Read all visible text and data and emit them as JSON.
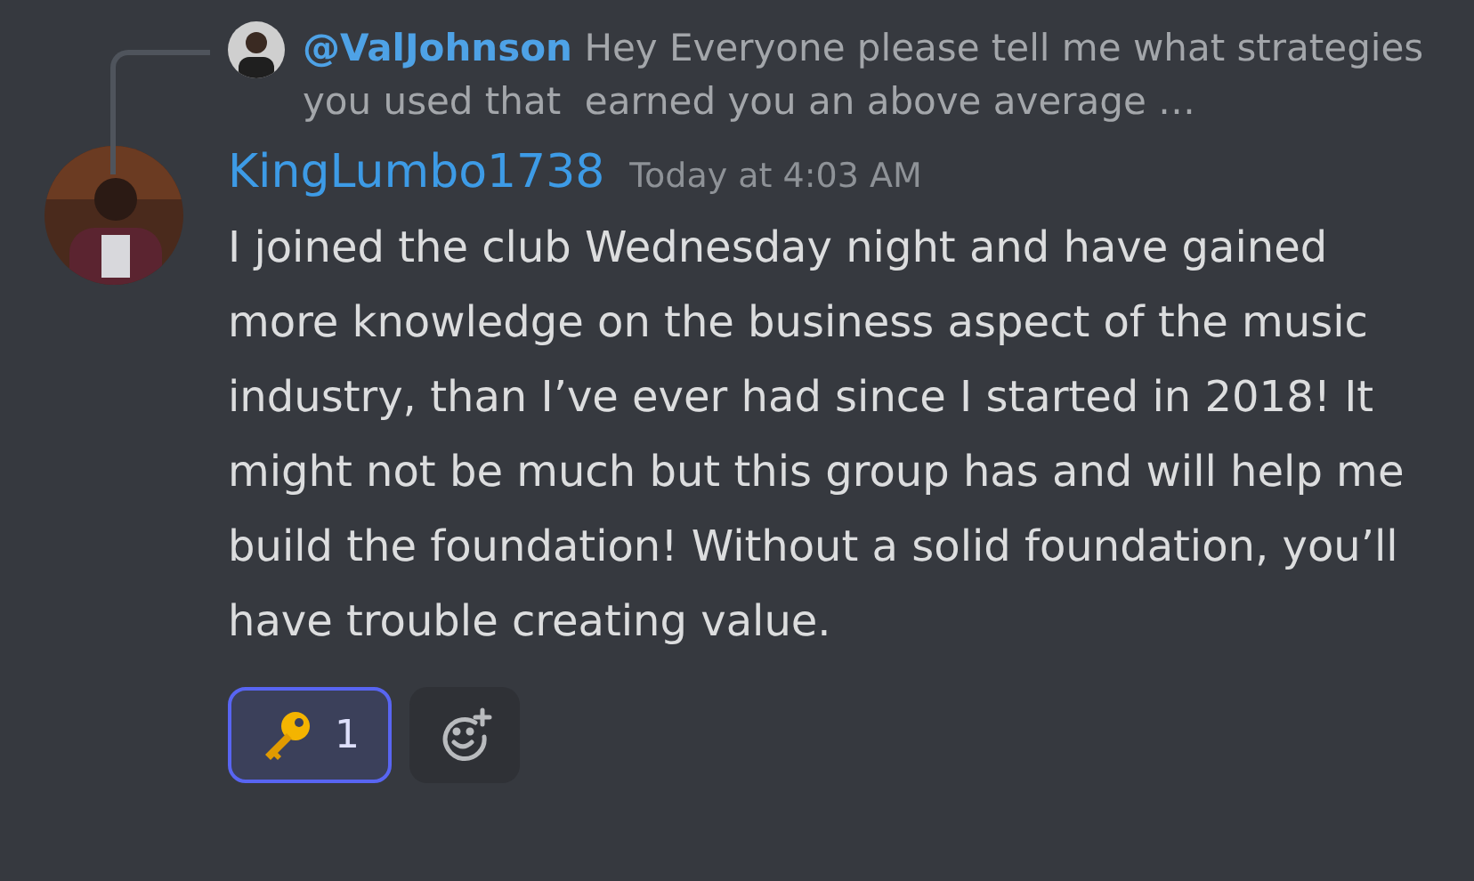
{
  "reply": {
    "mention": "@ValJohnson",
    "text": "Hey Everyone please tell me what strategies you used that  earned you an above average …"
  },
  "message": {
    "author": "KingLumbo1738",
    "timestamp": "Today at 4:03 AM",
    "body": "I joined the club Wednesday night and have gained more knowledge on the business aspect of the music industry, than I’ve ever had since I started in 2018! It might not be much but this group has and will help me build the foundation! Without a solid foundation, you’ll have trouble creating value."
  },
  "reactions": [
    {
      "kind": "emoji",
      "count": "1",
      "selected": true
    },
    {
      "kind": "add"
    }
  ]
}
